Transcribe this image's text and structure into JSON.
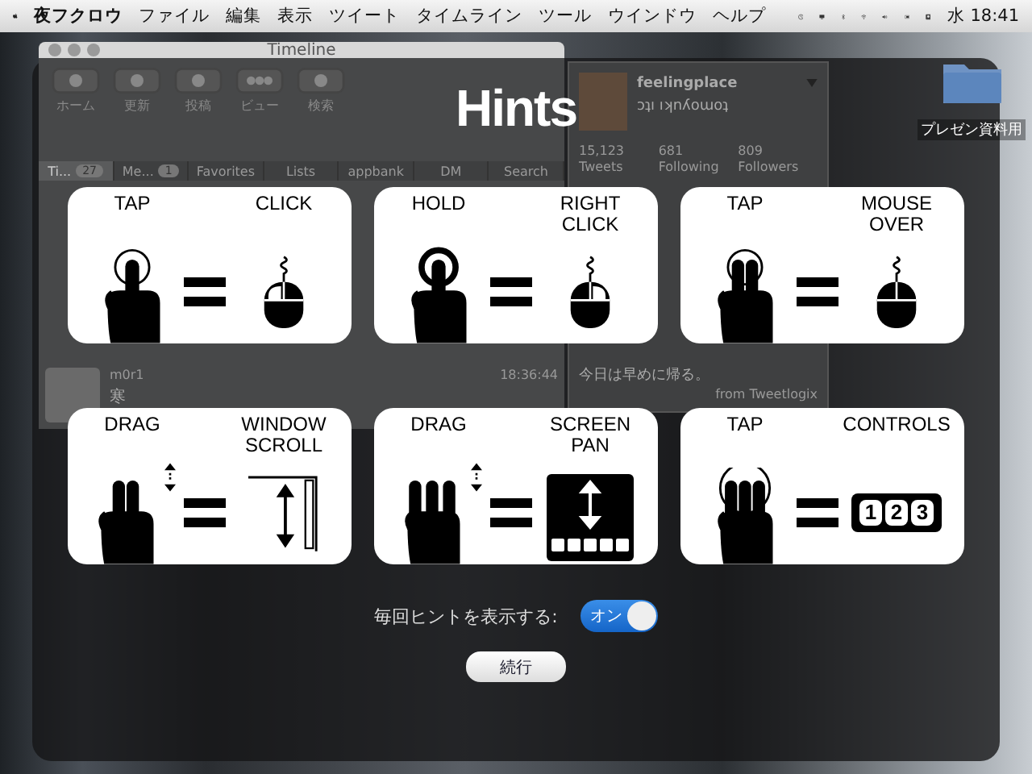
{
  "menubar": {
    "app": "夜フクロウ",
    "menus": [
      "ファイル",
      "編集",
      "表示",
      "ツイート",
      "タイムライン",
      "ツール",
      "ウインドウ",
      "ヘルプ"
    ],
    "clock": "水 18:41"
  },
  "desktop_icons": [
    {
      "label": "プレゼン資料用"
    }
  ],
  "timeline_window": {
    "title": "Timeline",
    "toolbar": [
      {
        "label": "ホーム",
        "kind": "home"
      },
      {
        "label": "更新",
        "kind": "refresh"
      },
      {
        "label": "投稿",
        "kind": "post"
      },
      {
        "label": "ビュー",
        "kind": "view"
      },
      {
        "label": "検索",
        "kind": "search"
      }
    ],
    "tabs": [
      {
        "label": "Ti...",
        "badge": "27",
        "selected": true
      },
      {
        "label": "Me...",
        "badge": "1",
        "selected": false
      },
      {
        "label": "Favorites",
        "selected": false
      },
      {
        "label": "Lists",
        "selected": false
      },
      {
        "label": "appbank",
        "selected": false
      },
      {
        "label": "DM",
        "selected": false
      },
      {
        "label": "Search",
        "selected": false
      }
    ],
    "tweets": [
      {
        "user": "m0r1",
        "time": "18:36:44",
        "text": "寒"
      }
    ]
  },
  "profile": {
    "name": "feelingplace",
    "handle": "ɔʇı ıʞnʎoɯoʇ",
    "stats": [
      {
        "value": "15,123",
        "label": "Tweets"
      },
      {
        "value": "681",
        "label": "Following"
      },
      {
        "value": "809",
        "label": "Followers"
      }
    ],
    "tweet_text": "今日は早めに帰る。",
    "source": "from Tweetlogix"
  },
  "hints": {
    "title": "Hints",
    "cards": [
      {
        "gesture": {
          "label": "TAP",
          "kind": "tap-one"
        },
        "action": {
          "label": "CLICK",
          "kind": "mouse-left"
        }
      },
      {
        "gesture": {
          "label": "HOLD",
          "kind": "hold-one"
        },
        "action": {
          "label": "RIGHT CLICK",
          "kind": "mouse-right"
        }
      },
      {
        "gesture": {
          "label": "TAP",
          "kind": "tap-two"
        },
        "action": {
          "label": "MOUSE OVER",
          "kind": "mouse"
        }
      },
      {
        "gesture": {
          "label": "DRAG",
          "kind": "drag-two"
        },
        "action": {
          "label": "WINDOW SCROLL",
          "kind": "window-scroll"
        }
      },
      {
        "gesture": {
          "label": "DRAG",
          "kind": "drag-three"
        },
        "action": {
          "label": "SCREEN PAN",
          "kind": "screen-pan"
        }
      },
      {
        "gesture": {
          "label": "TAP",
          "kind": "tap-three"
        },
        "action": {
          "label": "CONTROLS",
          "kind": "controls",
          "digits": [
            "1",
            "2",
            "3"
          ]
        }
      }
    ],
    "show_every_time": {
      "label": "毎回ヒントを表示する:",
      "on": true,
      "text": "オン"
    },
    "continue_button": "続行"
  }
}
